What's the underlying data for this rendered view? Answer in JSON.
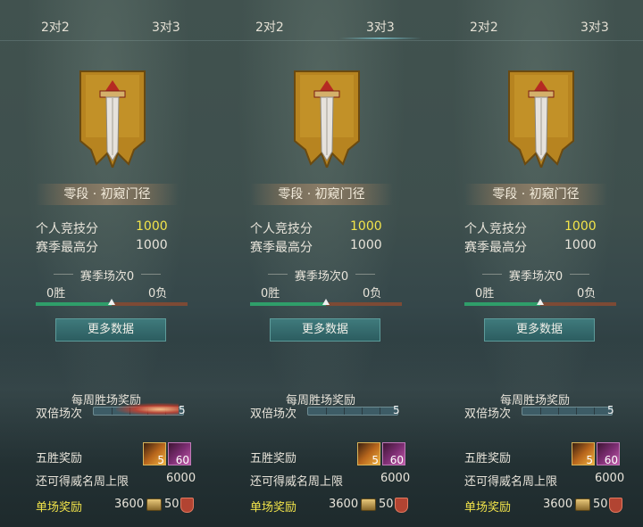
{
  "panels": [
    {
      "tabs": [
        "2对2",
        "3对3"
      ],
      "active_tab": 0,
      "rank": "零段 · 初窥门径",
      "stats": [
        {
          "label": "个人竞技分",
          "value": "1000"
        },
        {
          "label": "赛季最高分",
          "value": "1000"
        }
      ],
      "season": {
        "title": "赛季场次0",
        "wins": "0胜",
        "losses": "0负",
        "win_fraction": 0.5
      },
      "more_button": "更多数据",
      "weekly": {
        "title": "每周胜场奖励",
        "double_label": "双倍场次",
        "double_count": "5",
        "five_label": "五胜奖励",
        "item_counts": [
          "5",
          "60"
        ],
        "limit_label": "还可得威名周上限",
        "limit_value": "6000",
        "single_label": "单场奖励",
        "single_coin": "3600",
        "single_shield": "50"
      }
    },
    {
      "tabs": [
        "2对2",
        "3对3"
      ],
      "active_tab": 1,
      "rank": "零段 · 初窥门径",
      "stats": [
        {
          "label": "个人竞技分",
          "value": "1000"
        },
        {
          "label": "赛季最高分",
          "value": "1000"
        }
      ],
      "season": {
        "title": "赛季场次0",
        "wins": "0胜",
        "losses": "0负",
        "win_fraction": 0.5
      },
      "more_button": "更多数据",
      "weekly": {
        "title": "每周胜场奖励",
        "double_label": "双倍场次",
        "double_count": "5",
        "five_label": "五胜奖励",
        "item_counts": [
          "5",
          "60"
        ],
        "limit_label": "还可得威名周上限",
        "limit_value": "6000",
        "single_label": "单场奖励",
        "single_coin": "3600",
        "single_shield": "50"
      }
    },
    {
      "tabs": [
        "2对2",
        "3对3"
      ],
      "active_tab": 1,
      "rank": "零段 · 初窥门径",
      "stats": [
        {
          "label": "个人竞技分",
          "value": "1000"
        },
        {
          "label": "赛季最高分",
          "value": "1000"
        }
      ],
      "season": {
        "title": "赛季场次0",
        "wins": "0胜",
        "losses": "0负",
        "win_fraction": 0.5
      },
      "more_button": "更多数据",
      "weekly": {
        "title": "每周胜场奖励",
        "double_label": "双倍场次",
        "double_count": "5",
        "five_label": "五胜奖励",
        "item_counts": [
          "5",
          "60"
        ],
        "limit_label": "还可得威名周上限",
        "limit_value": "6000",
        "single_label": "单场奖励",
        "single_coin": "3600",
        "single_shield": "50"
      }
    }
  ],
  "colors": {
    "score_yellow": "#f2e44a",
    "bar_green": "#2f9e6a",
    "bar_loss": "#7d4a35",
    "button_teal": "#3f7a7c"
  }
}
